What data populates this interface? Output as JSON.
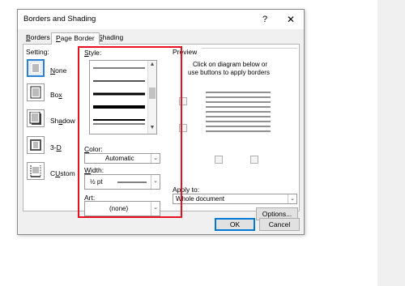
{
  "dialog": {
    "title": "Borders and Shading",
    "help": "?",
    "close": "✕"
  },
  "tabs": [
    {
      "label": "Borders",
      "u": "B",
      "rest": "orders",
      "active": false
    },
    {
      "label": "Page Border",
      "pre": "",
      "u": "P",
      "rest": "age Border",
      "active": true
    },
    {
      "label": "Shading",
      "u": "S",
      "rest": "hading",
      "active": false
    }
  ],
  "setting": {
    "label": "Setting:",
    "items": [
      {
        "label": "None",
        "u": "N",
        "rest": "one",
        "selected": true
      },
      {
        "label": "Box",
        "u": "x",
        "pre": "Bo",
        "selected": false
      },
      {
        "label": "Shadow",
        "u": "a",
        "pre": "Sh",
        "rest": "dow",
        "selected": false
      },
      {
        "label": "3-D",
        "u": "D",
        "pre": "3-",
        "selected": false
      },
      {
        "label": "Custom",
        "u": "U",
        "pre": "C",
        "rest": "stom",
        "selected": false
      }
    ]
  },
  "style": {
    "label": "Style:",
    "items": [
      "thin",
      "double",
      "thick",
      "thicker",
      "thick-thin"
    ]
  },
  "color": {
    "label": "Color:",
    "value": "Automatic"
  },
  "width": {
    "label": "Width:",
    "value": "½ pt"
  },
  "art": {
    "label": "Art:",
    "value": "(none)"
  },
  "preview": {
    "label": "Preview",
    "hint_line1": "Click on diagram below or",
    "hint_line2": "use buttons to apply borders"
  },
  "apply_to": {
    "label": "Apply to:",
    "value": "Whole document"
  },
  "buttons": {
    "options": "Options...",
    "ok": "OK",
    "cancel": "Cancel"
  },
  "colors": {
    "accent": "#0078d7",
    "highlight": "#e8101e",
    "selection": "#2a7fd6"
  }
}
